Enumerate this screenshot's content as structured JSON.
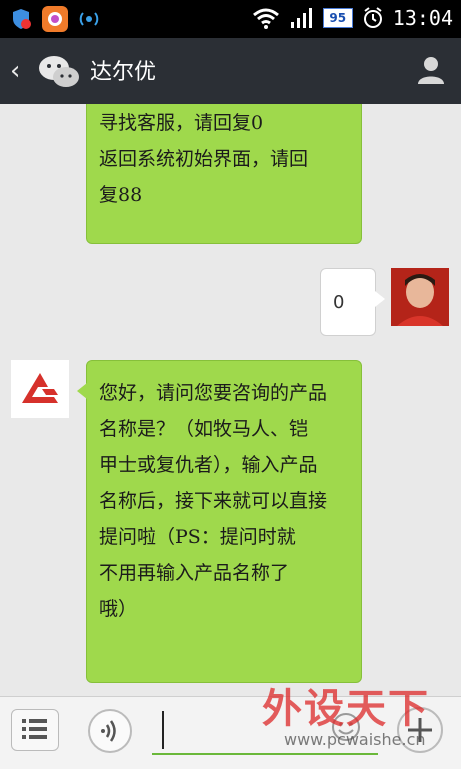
{
  "status_bar": {
    "battery": "95",
    "time": "13:04"
  },
  "title_bar": {
    "title": "达尔优"
  },
  "messages": [
    {
      "side": "left",
      "lines": [
        "寻找客服，请回复0",
        "返回系统初始界面，请回",
        "复88"
      ]
    },
    {
      "side": "right",
      "lines": [
        "0"
      ]
    },
    {
      "side": "left",
      "lines": [
        "您好，请问您要咨询的产品",
        "名称是？（如牧马人、铠",
        "甲士或复仇者），输入产品",
        "名称后，接下来就可以直接",
        "提问啦（PS：提问时就",
        "不用再输入产品名称了",
        "哦）"
      ]
    }
  ],
  "watermark": {
    "brand": "外设天下",
    "url": "www.pcwaishe.cn"
  },
  "colors": {
    "bubble_green": "#9fd94c",
    "title_bg": "#2b2f35",
    "chat_bg": "#e9e9e9"
  }
}
